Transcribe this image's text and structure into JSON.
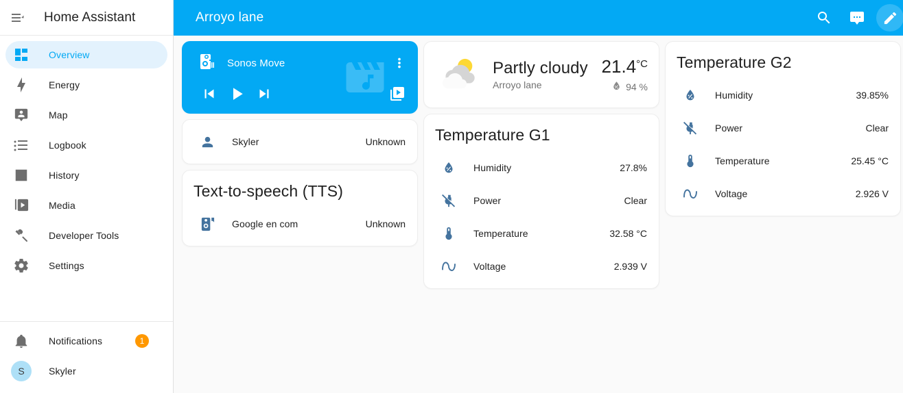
{
  "sidebar": {
    "title": "Home Assistant",
    "menu_icon": "menu-open-icon",
    "items": [
      {
        "label": "Overview",
        "icon": "view-dashboard-icon",
        "active": true
      },
      {
        "label": "Energy",
        "icon": "lightning-bolt-icon",
        "active": false
      },
      {
        "label": "Map",
        "icon": "map-marker-account-icon",
        "active": false
      },
      {
        "label": "Logbook",
        "icon": "format-list-bulleted-icon",
        "active": false
      },
      {
        "label": "History",
        "icon": "chart-box-icon",
        "active": false
      },
      {
        "label": "Media",
        "icon": "play-box-multiple-icon",
        "active": false
      },
      {
        "label": "Developer Tools",
        "icon": "hammer-icon",
        "active": false
      },
      {
        "label": "Settings",
        "icon": "cog-icon",
        "active": false
      }
    ],
    "notifications": {
      "label": "Notifications",
      "icon": "bell-icon",
      "badge": "1"
    },
    "user": {
      "label": "Skyler",
      "initial": "S"
    }
  },
  "topbar": {
    "title": "Arroyo lane",
    "search_icon": "search-icon",
    "assist_icon": "assist-chat-icon",
    "edit_icon": "pencil-icon"
  },
  "cards": {
    "media_player": {
      "name": "Sonos Move",
      "source_icon": "speaker-icon",
      "watermark_icon": "movie-music-icon",
      "more_icon": "dots-vertical-icon",
      "prev_icon": "skip-previous-icon",
      "play_icon": "play-icon",
      "next_icon": "skip-next-icon",
      "browse_icon": "play-box-multiple-icon",
      "accent_color": "#03a9f4"
    },
    "person": {
      "rows": [
        {
          "icon": "account-icon",
          "name": "Skyler",
          "value": "Unknown"
        }
      ]
    },
    "tts": {
      "title": "Text-to-speech (TTS)",
      "rows": [
        {
          "icon": "speaker-message-icon",
          "name": "Google en com",
          "value": "Unknown"
        }
      ]
    },
    "weather": {
      "icon": "partly-cloudy-icon",
      "state": "Partly cloudy",
      "location": "Arroyo lane",
      "temperature": "21.4",
      "temperature_unit": "°C",
      "humidity": "94 %",
      "humidity_icon": "water-percent-icon"
    },
    "temperature_g1": {
      "title": "Temperature G1",
      "rows": [
        {
          "icon": "water-percent-icon",
          "name": "Humidity",
          "value": "27.8%"
        },
        {
          "icon": "power-plug-off-icon",
          "name": "Power",
          "value": "Clear"
        },
        {
          "icon": "thermometer-icon",
          "name": "Temperature",
          "value": "32.58 °C"
        },
        {
          "icon": "sine-wave-icon",
          "name": "Voltage",
          "value": "2.939 V"
        }
      ]
    },
    "temperature_g2": {
      "title": "Temperature G2",
      "rows": [
        {
          "icon": "water-percent-icon",
          "name": "Humidity",
          "value": "39.85%"
        },
        {
          "icon": "power-plug-off-icon",
          "name": "Power",
          "value": "Clear"
        },
        {
          "icon": "thermometer-icon",
          "name": "Temperature",
          "value": "25.45 °C"
        },
        {
          "icon": "sine-wave-icon",
          "name": "Voltage",
          "value": "2.926 V"
        }
      ]
    }
  },
  "colors": {
    "accent": "#03a9f4",
    "state_icon": "#44739e",
    "badge": "#ff9800",
    "background": "#fafafa"
  }
}
